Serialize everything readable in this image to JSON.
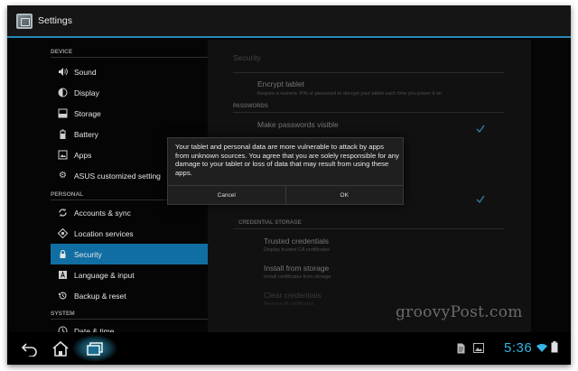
{
  "window": {
    "title": "Settings"
  },
  "sidebar": {
    "sections": [
      {
        "label": "DEVICE"
      },
      {
        "label": "PERSONAL"
      },
      {
        "label": "SYSTEM"
      }
    ],
    "items": [
      {
        "label": "Sound",
        "icon": "speaker-icon"
      },
      {
        "label": "Display",
        "icon": "display-icon"
      },
      {
        "label": "Storage",
        "icon": "storage-icon"
      },
      {
        "label": "Battery",
        "icon": "battery-icon"
      },
      {
        "label": "Apps",
        "icon": "apps-icon"
      },
      {
        "label": "ASUS customized setting",
        "icon": "gear-icon"
      },
      {
        "label": "Accounts & sync",
        "icon": "sync-icon"
      },
      {
        "label": "Location services",
        "icon": "location-icon"
      },
      {
        "label": "Security",
        "icon": "lock-icon",
        "selected": true
      },
      {
        "label": "Language & input",
        "icon": "language-icon"
      },
      {
        "label": "Backup & reset",
        "icon": "backup-icon"
      },
      {
        "label": "Date & time",
        "icon": "clock-icon"
      }
    ]
  },
  "panel": {
    "header": "Security",
    "encrypt": {
      "title": "Encrypt tablet",
      "subtitle": "Require a numeric PIN or password to decrypt your tablet each time you power it on"
    },
    "passwords_section": "PASSWORDS",
    "make_visible": {
      "title": "Make passwords visible",
      "checked": true
    },
    "unknown_sources": {
      "checked": true
    },
    "credential_section": "CREDENTIAL STORAGE",
    "trusted": {
      "title": "Trusted credentials",
      "subtitle": "Display trusted CA certificates"
    },
    "install": {
      "title": "Install from storage",
      "subtitle": "Install certificates from storage"
    },
    "clear": {
      "title": "Clear credentials",
      "subtitle": "Remove all certificates"
    }
  },
  "dialog": {
    "message": "Your tablet and personal data are more vulnerable to attack by apps from unknown sources. You agree that you are solely responsible for any damage to your tablet or loss of data that may result from using these apps.",
    "cancel_label": "Cancel",
    "ok_label": "OK"
  },
  "system_bar": {
    "time": "5:36",
    "nav": [
      "back-icon",
      "home-icon",
      "recent-apps-icon"
    ],
    "status": [
      "file-icon",
      "image-icon",
      "wifi-icon",
      "battery-status-icon"
    ]
  },
  "watermark": "groovyPost.com",
  "colors": {
    "accent": "#33b5e5",
    "selected": "#116ea3",
    "action_bar_line": "#2a88b6"
  }
}
